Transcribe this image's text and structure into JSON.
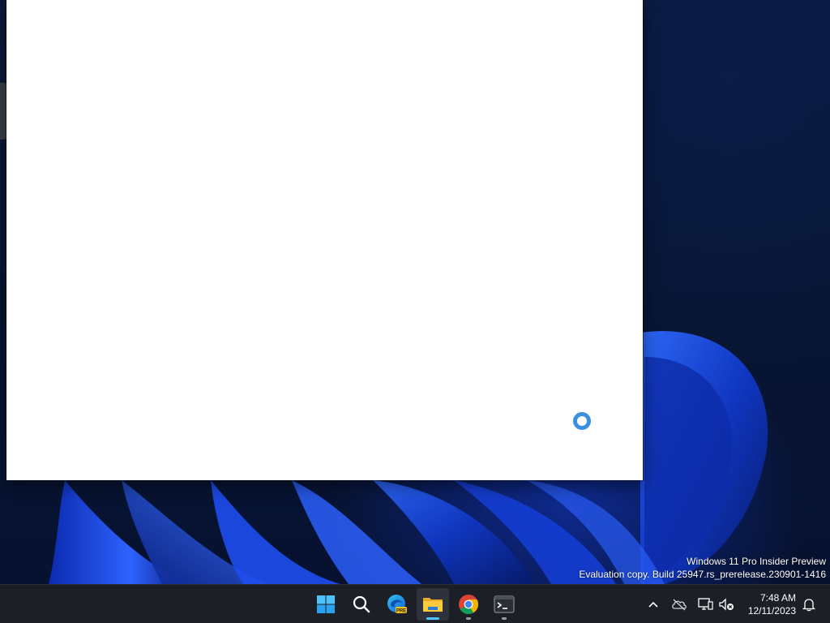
{
  "desktop": {
    "watermark": {
      "line1": "Windows 11 Pro Insider Preview",
      "line2": "Evaluation copy. Build 25947.rs_prerelease.230901-1416"
    }
  },
  "window": {
    "state": "loading"
  },
  "taskbar": {
    "apps": [
      {
        "name": "start-button",
        "icon": "windows-logo-icon"
      },
      {
        "name": "search-button",
        "icon": "search-icon"
      },
      {
        "name": "edge-preview-app",
        "icon": "edge-preview-icon",
        "badge": "PRE"
      },
      {
        "name": "file-explorer-app",
        "icon": "folder-icon",
        "active": true
      },
      {
        "name": "chrome-app",
        "icon": "chrome-icon"
      },
      {
        "name": "terminal-app",
        "icon": "terminal-icon"
      }
    ],
    "tray": {
      "icons": [
        "chevron-up-icon",
        "onedrive-offline-icon",
        "network-icon",
        "volume-muted-icon",
        "notification-bell-icon"
      ],
      "time": "7:48 AM",
      "date": "12/11/2023"
    }
  },
  "colors": {
    "taskbar_bg": "#1c1f26",
    "accent": "#4cc2ff",
    "spinner": "#3b8fe0"
  }
}
